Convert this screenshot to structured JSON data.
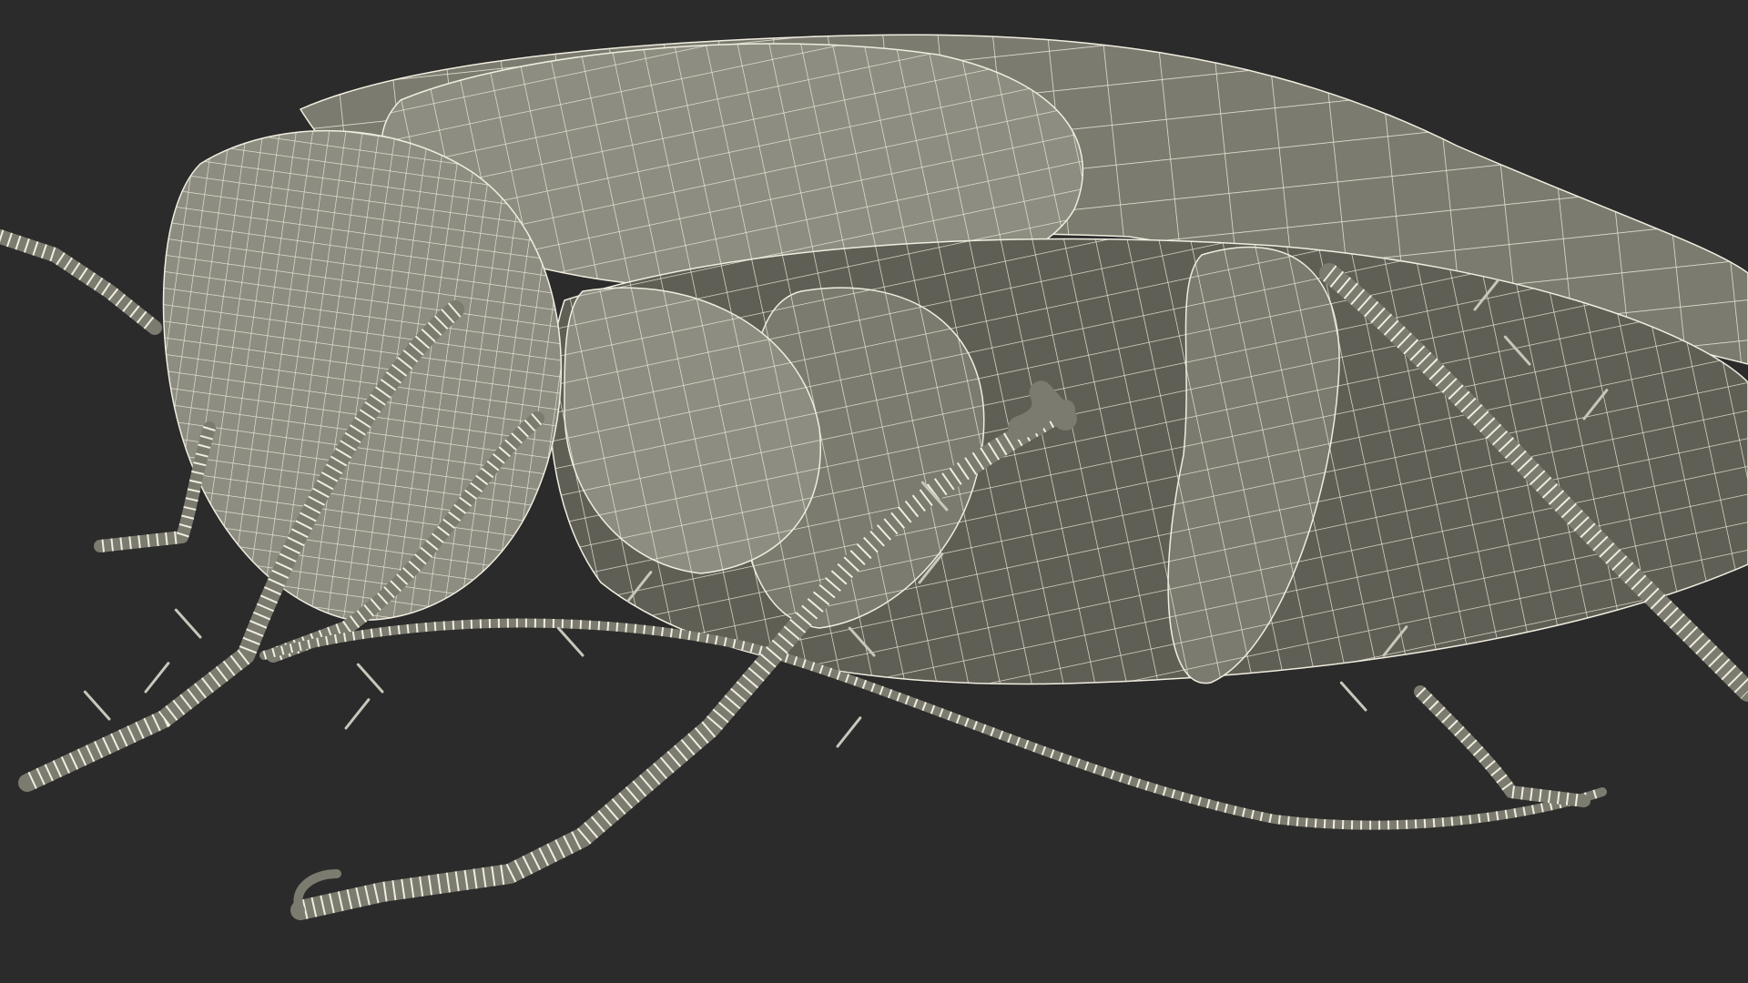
{
  "scene": {
    "subject": "cockroach-wireframe-render",
    "colors": {
      "background": "#2b2b2b",
      "surface": "#7b7b6f",
      "surface_dark": "#5f5f55",
      "surface_light": "#8d8d81",
      "wire": "#f1ede0",
      "spike": "#c9c7bb"
    },
    "icons": [
      "cockroach-wireframe-icon"
    ]
  }
}
